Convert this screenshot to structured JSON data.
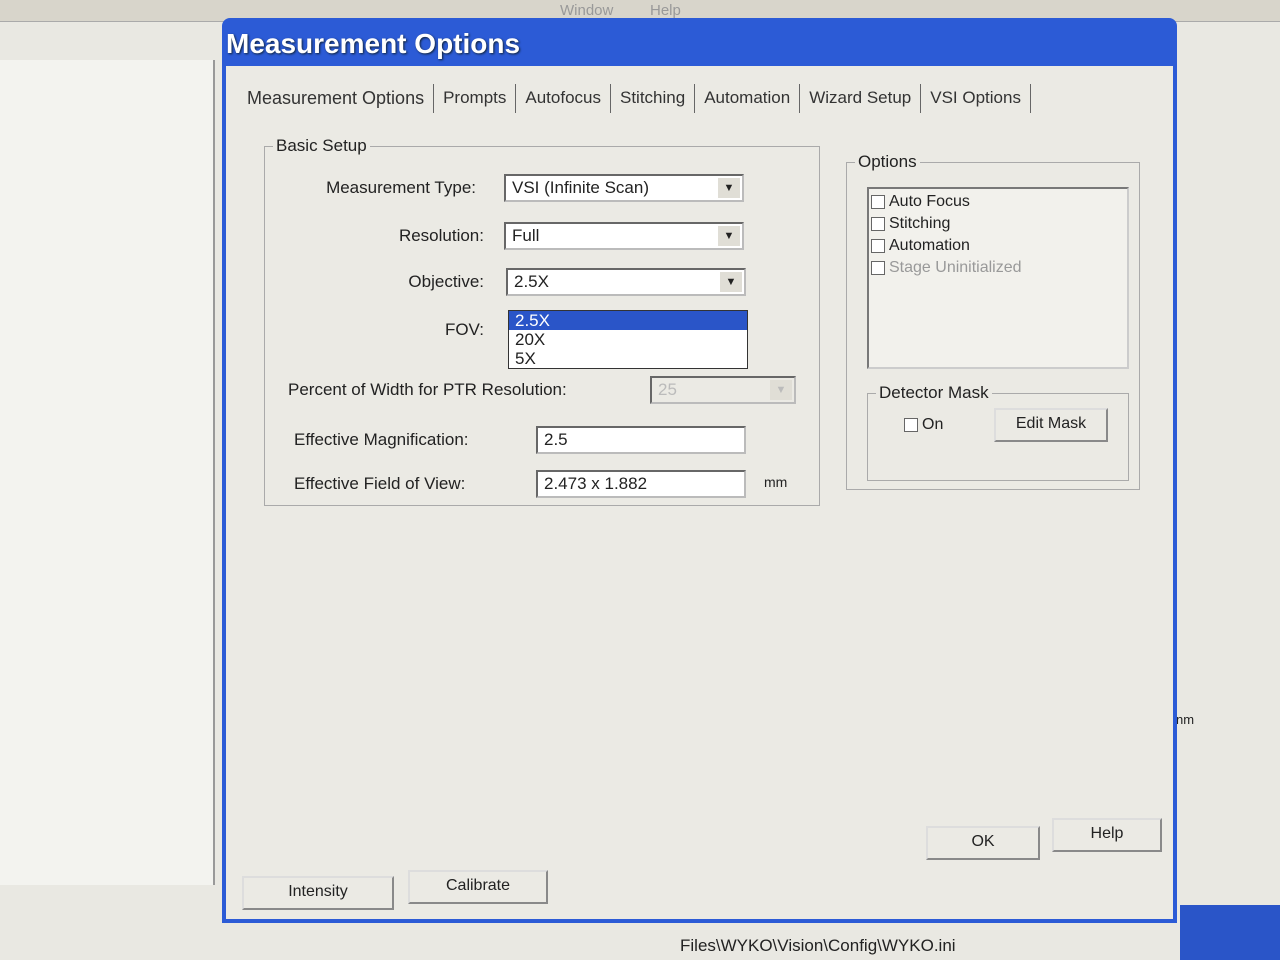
{
  "app": {
    "menu": [
      "Window",
      "Help"
    ],
    "status_path": "Files\\WYKO\\Vision\\Config\\WYKO.ini",
    "right_unit": "nm"
  },
  "dialog": {
    "title": "Measurement Options",
    "tabs": [
      "Measurement Options",
      "Prompts",
      "Autofocus",
      "Stitching",
      "Automation",
      "Wizard Setup",
      "VSI Options"
    ],
    "basic_setup": {
      "title": "Basic Setup",
      "measurement_type_label": "Measurement Type:",
      "measurement_type": "VSI (Infinite Scan)",
      "resolution_label": "Resolution:",
      "resolution": "Full",
      "objective_label": "Objective:",
      "objective": "2.5X",
      "objective_options": [
        "2.5X",
        "20X",
        "5X"
      ],
      "fov_label": "FOV:",
      "ptr_label": "Percent of Width for PTR Resolution:",
      "ptr_value": "25",
      "eff_mag_label": "Effective Magnification:",
      "eff_mag": "2.5",
      "eff_fov_label": "Effective Field of View:",
      "eff_fov": "2.473 x 1.882",
      "eff_fov_unit": "mm"
    },
    "options": {
      "title": "Options",
      "items": [
        {
          "label": "Auto Focus",
          "checked": false
        },
        {
          "label": "Stitching",
          "checked": false
        },
        {
          "label": "Automation",
          "checked": false
        },
        {
          "label": "Stage Uninitialized",
          "checked": false,
          "disabled": true
        }
      ]
    },
    "detector_mask": {
      "title": "Detector Mask",
      "on_label": "On",
      "on_checked": false,
      "edit_label": "Edit Mask"
    },
    "buttons": {
      "ok": "OK",
      "help": "Help",
      "intensity": "Intensity",
      "calibrate": "Calibrate"
    }
  }
}
